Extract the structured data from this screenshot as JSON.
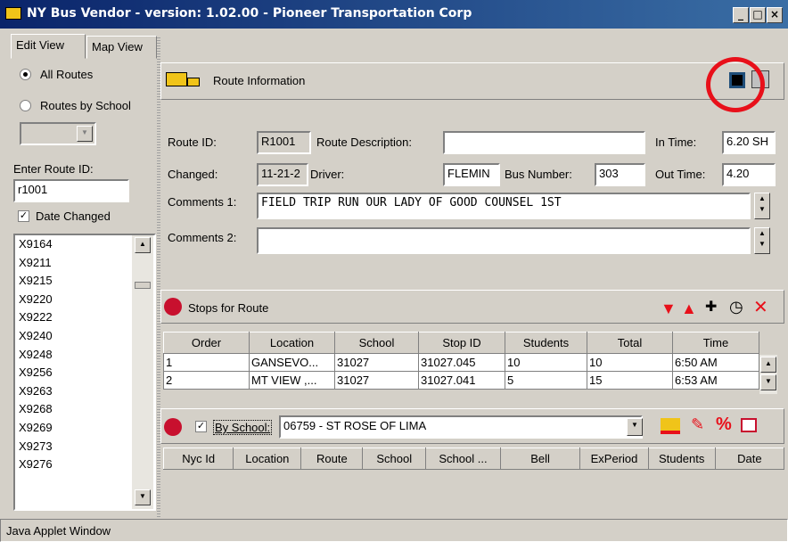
{
  "window": {
    "title": "NY Bus Vendor - version: 1.02.00 - Pioneer Transportation Corp",
    "min": "_",
    "max": "□",
    "close": "×"
  },
  "tabs": [
    "Edit View",
    "Map View"
  ],
  "sidebar": {
    "radio_all": "All Routes",
    "radio_school": "Routes by School",
    "enter_route_label": "Enter Route ID:",
    "route_input": "r1001",
    "date_changed": "Date Changed",
    "routes": [
      "X9164",
      "X9211",
      "X9215",
      "X9220",
      "X9222",
      "X9240",
      "X9248",
      "X9256",
      "X9263",
      "X9268",
      "X9269",
      "X9273",
      "X9276"
    ]
  },
  "route_info": {
    "header": "Route Information",
    "route_id_label": "Route ID:",
    "route_id": "R1001",
    "route_desc_label": "Route Description:",
    "route_desc": "",
    "in_time_label": "In Time:",
    "in_time": "6.20 SH",
    "changed_label": "Changed:",
    "changed": "11-21-2",
    "driver_label": "Driver:",
    "driver": "FLEMIN",
    "bus_number_label": "Bus Number:",
    "bus_number": "303",
    "out_time_label": "Out Time:",
    "out_time": "4.20",
    "comments1_label": "Comments 1:",
    "comments1": "FIELD TRIP RUN    OUR LADY OF GOOD COUNSEL 1ST",
    "comments2_label": "Comments 2:",
    "comments2": ""
  },
  "stops": {
    "header": "Stops for Route",
    "columns": [
      "Order",
      "Location",
      "School",
      "Stop ID",
      "Students",
      "Total",
      "Time"
    ],
    "rows": [
      [
        "1",
        "GANSEVO...",
        "31027",
        "31027.045",
        "10",
        "10",
        "6:50 AM"
      ],
      [
        "2",
        "MT VIEW ,...",
        "31027",
        "31027.041",
        "5",
        "15",
        "6:53 AM"
      ]
    ]
  },
  "school": {
    "by_school_label": "By School:",
    "selected": "06759 - ST ROSE OF LIMA",
    "columns": [
      "Nyc Id",
      "Location",
      "Route",
      "School",
      "School ...",
      "Bell",
      "ExPeriod",
      "Students",
      "Date"
    ]
  },
  "status": "Java Applet Window",
  "colors": {
    "title_bar": "#0a246a",
    "highlight_circle": "#e8101a",
    "stop_red": "#c8102e"
  }
}
